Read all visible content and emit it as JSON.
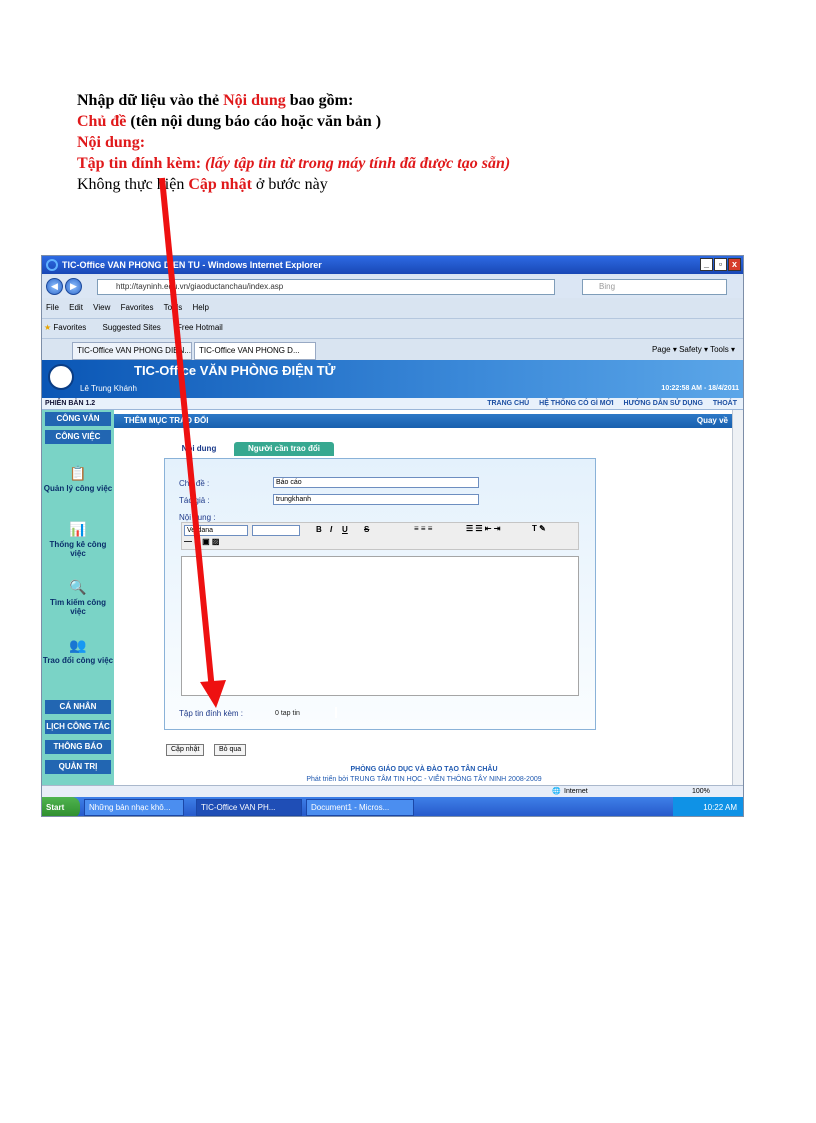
{
  "instructions": {
    "line1_prefix": "Nhập dữ liệu vào thẻ ",
    "line1_highlight": "Nội dung",
    "line1_suffix": " bao gồm:",
    "line2_highlight": "Chủ đề",
    "line2_suffix": " (tên nội dung báo cáo hoặc văn bản )",
    "line3_highlight": "Nội dung:",
    "line4_highlight": "Tập tin đính kèm:",
    "line4_italic": " (lấy tập tin từ trong máy tính đã được tạo sẵn)",
    "line5_prefix": "Không thực hiện ",
    "line5_highlight": "Cập nhật",
    "line5_suffix": " ở bước này"
  },
  "browser": {
    "window_title": "TIC-Office VAN PHONG DIEN TU - Windows Internet Explorer",
    "url": "http://tayninh.edu.vn/giaoductanchau/index.asp",
    "search_placeholder": "Bing",
    "menu": [
      "File",
      "Edit",
      "View",
      "Favorites",
      "Tools",
      "Help"
    ],
    "favorites_label": "Favorites",
    "suggested_sites": "Suggested Sites",
    "free_hotmail": "Free Hotmail",
    "tabs": [
      "TIC-Office VAN PHONG DIEN...",
      "TIC-Office VAN PHONG D..."
    ],
    "command_bar": "Page ▾  Safety ▾  Tools ▾"
  },
  "app": {
    "title": "TIC-Office VĂN PHÒNG ĐIỆN TỬ",
    "user": "Lê Trung Khánh",
    "time": "10:22:58 AM - 18/4/2011",
    "version": "PHIÊN BẢN 1.2",
    "top_links": [
      "TRANG CHỦ",
      "HỆ THỐNG CÓ GÌ MỚI",
      "HƯỚNG DẪN SỬ DỤNG",
      "THOÁT"
    ],
    "sidebar": {
      "headers_top": [
        "CÔNG VĂN",
        "CÔNG VIỆC"
      ],
      "items": [
        "Quản lý công việc",
        "Thống kê công việc",
        "Tìm kiếm công việc",
        "Trao đổi công việc"
      ],
      "headers_bottom": [
        "CÁ NHÂN",
        "LỊCH CÔNG TÁC",
        "THÔNG BÁO",
        "QUẢN TRỊ"
      ]
    },
    "section_title": "THÊM MỤC TRAO ĐỔI",
    "back_link": "Quay về",
    "tabs": [
      "Nội dung",
      "Người cần trao đổi"
    ],
    "form": {
      "subject_label": "Chủ đề :",
      "subject_value": "Báo cáo",
      "author_label": "Tác giả :",
      "author_value": "trungkhanh",
      "content_label": "Nội dung :",
      "font_value": "Verdana",
      "attachment_label": "Tập tin đính kèm :",
      "attachment_count": "0 tap tin"
    },
    "buttons": {
      "update": "Cập nhật",
      "skip": "Bỏ qua"
    },
    "footer_line1": "PHÒNG GIÁO DỤC VÀ ĐÀO TẠO TÂN CHÂU",
    "footer_line2": "Phát triển bởi TRUNG TÂM TIN HỌC - VIỄN THÔNG TÂY NINH 2008-2009"
  },
  "status": {
    "zone": "Internet",
    "zoom": "100%"
  },
  "taskbar": {
    "start": "Start",
    "tasks": [
      "Những bản nhạc khô...",
      "TIC-Office VAN PH...",
      "Document1 - Micros..."
    ],
    "clock": "10:22 AM"
  },
  "colors": {
    "highlight_red": "#e0191b",
    "arrow_red": "#ee1111"
  }
}
